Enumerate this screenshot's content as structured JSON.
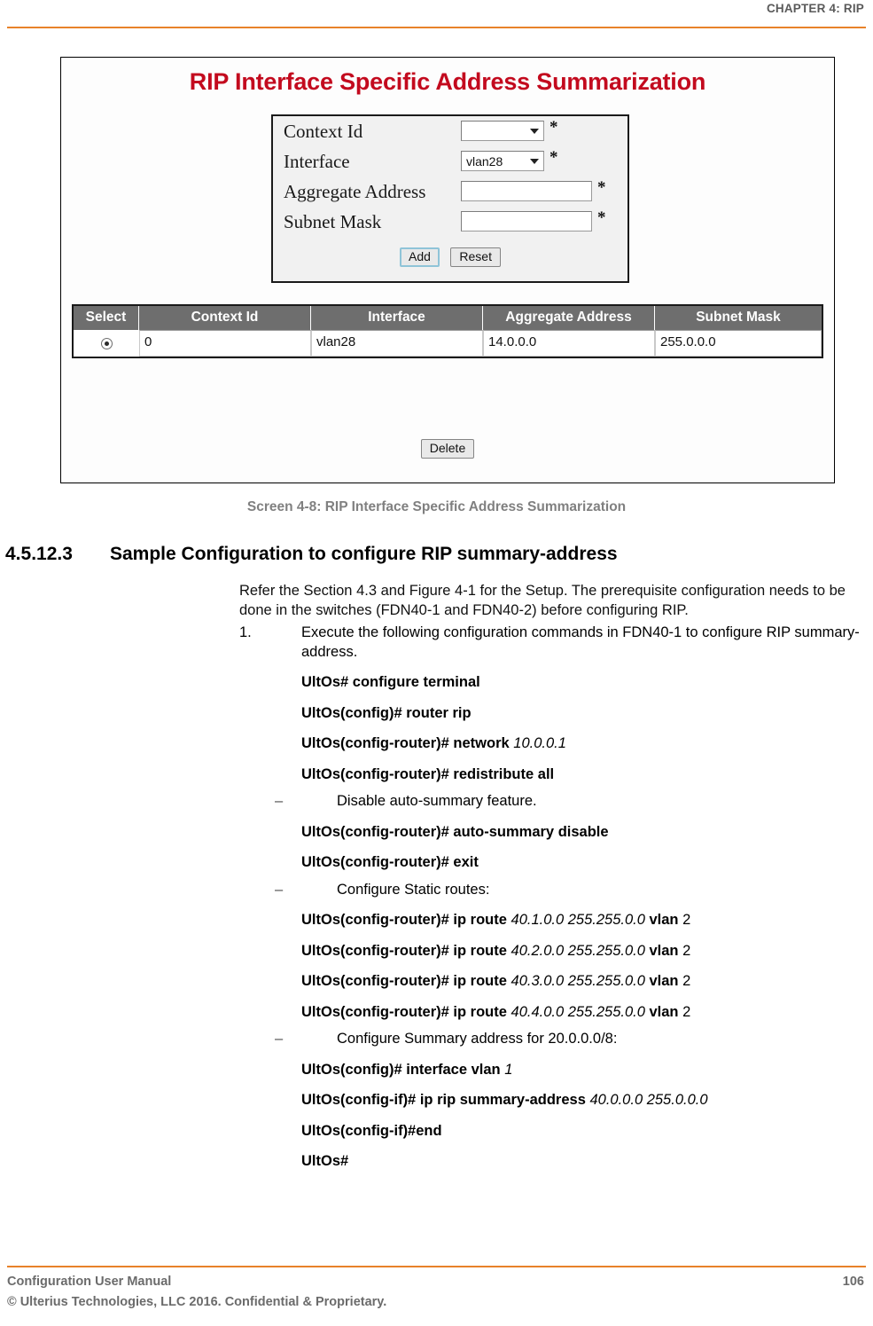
{
  "header": {
    "chapter": "CHAPTER 4: RIP"
  },
  "figure": {
    "title": "RIP Interface Specific Address Summarization",
    "caption": "Screen 4-8: RIP Interface Specific Address Summarization",
    "accent_red": "#c30a1e",
    "form": {
      "fields": [
        {
          "label": "Context Id",
          "control": "select",
          "value": "",
          "required": "*"
        },
        {
          "label": "Interface",
          "control": "select",
          "value": "vlan28",
          "required": "*"
        },
        {
          "label": "Aggregate Address",
          "control": "text",
          "value": "",
          "required": "*"
        },
        {
          "label": "Subnet Mask",
          "control": "text",
          "value": "",
          "required": "*"
        }
      ],
      "add_label": "Add",
      "reset_label": "Reset"
    },
    "table": {
      "columns": [
        "Select",
        "Context Id",
        "Interface",
        "Aggregate Address",
        "Subnet Mask"
      ],
      "rows": [
        {
          "selected": true,
          "context_id": "0",
          "interface": "vlan28",
          "aggregate_address": "14.0.0.0",
          "subnet_mask": "255.0.0.0"
        }
      ],
      "delete_label": "Delete"
    }
  },
  "section": {
    "number": "4.5.12.3",
    "title": "Sample Configuration to configure RIP summary-address"
  },
  "body": {
    "intro": "Refer the Section 4.3 and Figure 4-1 for the Setup. The prerequisite configuration needs to be done in the switches (FDN40-1 and FDN40-2) before configuring RIP.",
    "step1_num": "1.",
    "step1_text": "Execute the following configuration commands in FDN40-1 to configure RIP summary-address.",
    "dash": "–",
    "bullet_disable": "Disable auto-summary feature.",
    "bullet_static": "Configure Static routes:",
    "bullet_summary": "Configure Summary address for 20.0.0.0/8:",
    "commands": [
      {
        "prompt": "UltOs# configure terminal",
        "arg": "",
        "tail_bold": "",
        "tail_plain": ""
      },
      {
        "prompt": "UltOs(config)# router rip",
        "arg": "",
        "tail_bold": "",
        "tail_plain": ""
      },
      {
        "prompt": "UltOs(config-router)# network",
        "arg": "10.0.0.1",
        "tail_bold": "",
        "tail_plain": ""
      },
      {
        "prompt": "UltOs(config-router)# redistribute all",
        "arg": "",
        "tail_bold": "",
        "tail_plain": ""
      },
      {
        "prompt": "UltOs(config-router)# auto-summary disable",
        "arg": "",
        "tail_bold": "",
        "tail_plain": ""
      },
      {
        "prompt": "UltOs(config-router)# exit",
        "arg": "",
        "tail_bold": "",
        "tail_plain": ""
      },
      {
        "prompt": "UltOs(config-router)# ip route",
        "arg": "40.1.0.0 255.255.0.0",
        "tail_bold": "vlan",
        "tail_plain": "2"
      },
      {
        "prompt": "UltOs(config-router)# ip route",
        "arg": "40.2.0.0 255.255.0.0",
        "tail_bold": "vlan",
        "tail_plain": "2"
      },
      {
        "prompt": "UltOs(config-router)# ip route",
        "arg": "40.3.0.0 255.255.0.0",
        "tail_bold": "vlan",
        "tail_plain": "2"
      },
      {
        "prompt": "UltOs(config-router)# ip route",
        "arg": "40.4.0.0 255.255.0.0",
        "tail_bold": "vlan",
        "tail_plain": "2"
      },
      {
        "prompt": "UltOs(config)# interface vlan",
        "arg": "1",
        "tail_bold": "",
        "tail_plain": ""
      },
      {
        "prompt": "UltOs(config-if)# ip rip summary-address",
        "arg": "40.0.0.0 255.0.0.0",
        "tail_bold": "",
        "tail_plain": ""
      },
      {
        "prompt": "UltOs(config-if)#end",
        "arg": "",
        "tail_bold": "",
        "tail_plain": ""
      },
      {
        "prompt": "UltOs#",
        "arg": "",
        "tail_bold": "",
        "tail_plain": ""
      }
    ]
  },
  "footer": {
    "manual": "Configuration User Manual",
    "copyright": "© Ulterius Technologies, LLC 2016. Confidential & Proprietary.",
    "page": "106",
    "rule_color": "#e8822a"
  }
}
